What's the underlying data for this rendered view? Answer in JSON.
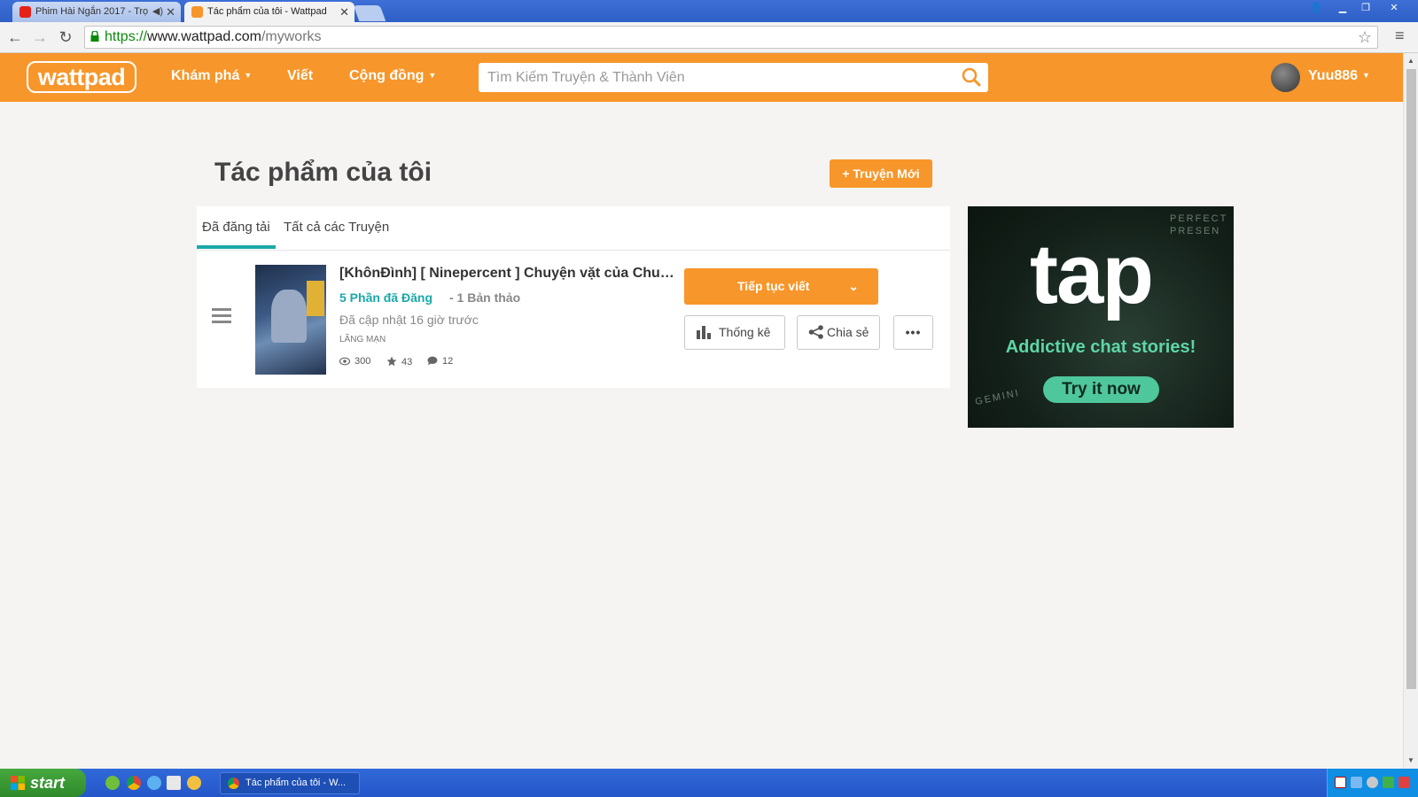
{
  "browser": {
    "tabs": [
      {
        "title": "Phim Hài Ngắn 2017 - Trọ",
        "active": false
      },
      {
        "title": "Tác phẩm của tôi - Wattpad",
        "active": true
      }
    ],
    "url_scheme": "https://",
    "url_host": "www.wattpad.com",
    "url_path": "/myworks"
  },
  "header": {
    "logo": "wattpad",
    "nav": {
      "explore": "Khám phá",
      "write": "Viết",
      "community": "Cộng đồng"
    },
    "search_placeholder": "Tìm Kiếm Truyện & Thành Viên",
    "username": "Yuu886"
  },
  "main": {
    "page_title": "Tác phẩm của tôi",
    "new_story_label": "+ Truyện Mới",
    "tabs": [
      {
        "label": "Đã đăng tải",
        "selected": true
      },
      {
        "label": "Tất cả các Truyện",
        "selected": false
      }
    ],
    "story": {
      "title": "[KhônĐình] [ Ninepercent ] Chuyện vặt của Chung Thần Lạc",
      "parts_published": "5 Phần đã Đăng",
      "drafts": "- 1 Bản thảo",
      "updated": "Đã cập nhật 16 giờ trước",
      "genre": "Lãng mạn",
      "views": "300",
      "votes": "43",
      "comments": "12",
      "continue_label": "Tiếp tục viết",
      "stats_label": "Thống kê",
      "share_label": "Chia sẻ",
      "more_label": "•••"
    }
  },
  "ad": {
    "brand": "tap",
    "tagline": "Addictive chat stories!",
    "cta": "Try it now"
  },
  "taskbar": {
    "start_label": "start",
    "task_item": "Tác phẩm của tôi - W..."
  },
  "colors": {
    "brand_orange": "#f7962a",
    "teal": "#1ba8a8"
  }
}
